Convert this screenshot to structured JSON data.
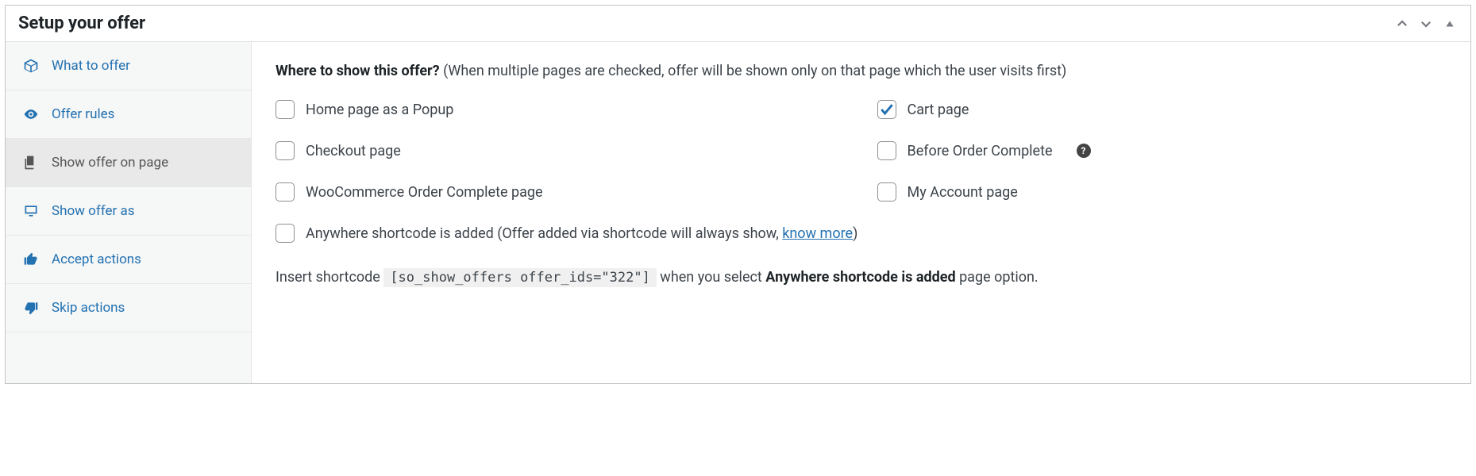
{
  "panel": {
    "title": "Setup your offer"
  },
  "sidebar": {
    "items": [
      {
        "label": "What to offer"
      },
      {
        "label": "Offer rules"
      },
      {
        "label": "Show offer on page"
      },
      {
        "label": "Show offer as"
      },
      {
        "label": "Accept actions"
      },
      {
        "label": "Skip actions"
      }
    ]
  },
  "content": {
    "heading_bold": "Where to show this offer?",
    "heading_sub": "(When multiple pages are checked, offer will be shown only on that page which the user visits first)",
    "options": {
      "home_popup": {
        "label": "Home page as a Popup",
        "checked": false
      },
      "cart": {
        "label": "Cart page",
        "checked": true
      },
      "checkout": {
        "label": "Checkout page",
        "checked": false
      },
      "before_order": {
        "label": "Before Order Complete",
        "checked": false,
        "help": true
      },
      "woo_complete": {
        "label": "WooCommerce Order Complete page",
        "checked": false
      },
      "my_account": {
        "label": "My Account page",
        "checked": false
      },
      "anywhere": {
        "label_pre": "Anywhere shortcode is added (Offer added via shortcode will always show, ",
        "link": "know more",
        "label_post": ")",
        "checked": false
      }
    },
    "shortcode": {
      "pre": "Insert shortcode ",
      "code": "[so_show_offers offer_ids=\"322\"]",
      "mid": " when you select ",
      "strong": "Anywhere shortcode is added",
      "post": " page option."
    },
    "help_glyph": "?"
  }
}
